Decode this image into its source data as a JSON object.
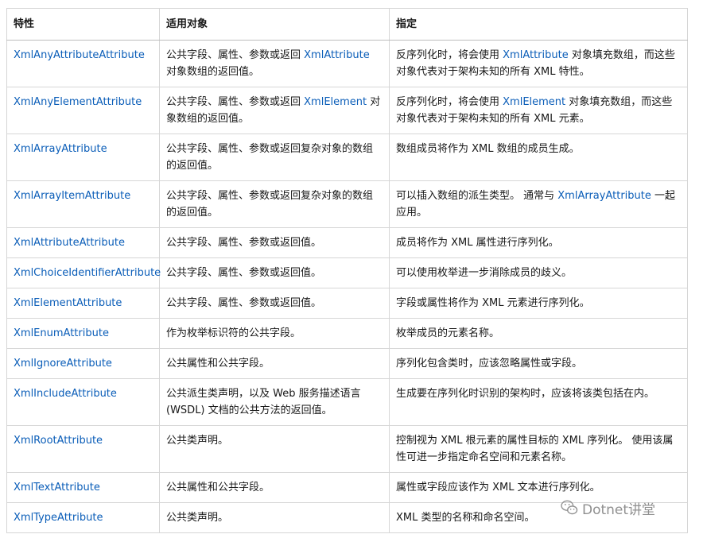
{
  "table": {
    "headers": [
      "特性",
      "适用对象",
      "指定"
    ],
    "rows": [
      {
        "attr": "XmlAnyAttributeAttribute",
        "applies": [
          {
            "t": "公共字段、属性、参数或返回 "
          },
          {
            "t": "XmlAttribute",
            "link": true
          },
          {
            "t": " 对象数组的返回值。"
          }
        ],
        "spec": [
          {
            "t": "反序列化时，将会使用 "
          },
          {
            "t": "XmlAttribute",
            "link": true
          },
          {
            "t": " 对象填充数组，而这些对象代表对于架构未知的所有 XML 特性。"
          }
        ]
      },
      {
        "attr": "XmlAnyElementAttribute",
        "applies": [
          {
            "t": "公共字段、属性、参数或返回 "
          },
          {
            "t": "XmlElement",
            "link": true
          },
          {
            "t": " 对象数组的返回值。"
          }
        ],
        "spec": [
          {
            "t": "反序列化时，将会使用 "
          },
          {
            "t": "XmlElement",
            "link": true
          },
          {
            "t": " 对象填充数组，而这些对象代表对于架构未知的所有 XML 元素。"
          }
        ]
      },
      {
        "attr": "XmlArrayAttribute",
        "applies": [
          {
            "t": "公共字段、属性、参数或返回复杂对象的数组的返回值。"
          }
        ],
        "spec": [
          {
            "t": "数组成员将作为 XML 数组的成员生成。"
          }
        ]
      },
      {
        "attr": "XmlArrayItemAttribute",
        "applies": [
          {
            "t": "公共字段、属性、参数或返回复杂对象的数组的返回值。"
          }
        ],
        "spec": [
          {
            "t": "可以插入数组的派生类型。 通常与 "
          },
          {
            "t": "XmlArrayAttribute",
            "link": true
          },
          {
            "t": " 一起应用。"
          }
        ]
      },
      {
        "attr": "XmlAttributeAttribute",
        "applies": [
          {
            "t": "公共字段、属性、参数或返回值。"
          }
        ],
        "spec": [
          {
            "t": "成员将作为 XML 属性进行序列化。"
          }
        ]
      },
      {
        "attr": "XmlChoiceIdentifierAttribute",
        "applies": [
          {
            "t": "公共字段、属性、参数或返回值。"
          }
        ],
        "spec": [
          {
            "t": "可以使用枚举进一步消除成员的歧义。"
          }
        ]
      },
      {
        "attr": "XmlElementAttribute",
        "applies": [
          {
            "t": "公共字段、属性、参数或返回值。"
          }
        ],
        "spec": [
          {
            "t": "字段或属性将作为 XML 元素进行序列化。"
          }
        ]
      },
      {
        "attr": "XmlEnumAttribute",
        "applies": [
          {
            "t": "作为枚举标识符的公共字段。"
          }
        ],
        "spec": [
          {
            "t": "枚举成员的元素名称。"
          }
        ]
      },
      {
        "attr": "XmlIgnoreAttribute",
        "applies": [
          {
            "t": "公共属性和公共字段。"
          }
        ],
        "spec": [
          {
            "t": "序列化包含类时，应该忽略属性或字段。"
          }
        ]
      },
      {
        "attr": "XmlIncludeAttribute",
        "applies": [
          {
            "t": "公共派生类声明，以及 Web 服务描述语言 (WSDL) 文档的公共方法的返回值。"
          }
        ],
        "spec": [
          {
            "t": "生成要在序列化时识别的架构时，应该将该类包括在内。"
          }
        ]
      },
      {
        "attr": "XmlRootAttribute",
        "applies": [
          {
            "t": "公共类声明。"
          }
        ],
        "spec": [
          {
            "t": "控制视为 XML 根元素的属性目标的 XML 序列化。 使用该属性可进一步指定命名空间和元素名称。"
          }
        ]
      },
      {
        "attr": "XmlTextAttribute",
        "applies": [
          {
            "t": "公共属性和公共字段。"
          }
        ],
        "spec": [
          {
            "t": "属性或字段应该作为 XML 文本进行序列化。"
          }
        ]
      },
      {
        "attr": "XmlTypeAttribute",
        "applies": [
          {
            "t": "公共类声明。"
          }
        ],
        "spec": [
          {
            "t": "XML 类型的名称和命名空间。"
          }
        ]
      }
    ]
  },
  "watermark": {
    "text": "Dotnet讲堂",
    "icon": "wechat-icon"
  },
  "colors": {
    "link": "#0a5db8",
    "border": "#d6d6d6",
    "text": "#171717",
    "watermark": "#909090"
  }
}
